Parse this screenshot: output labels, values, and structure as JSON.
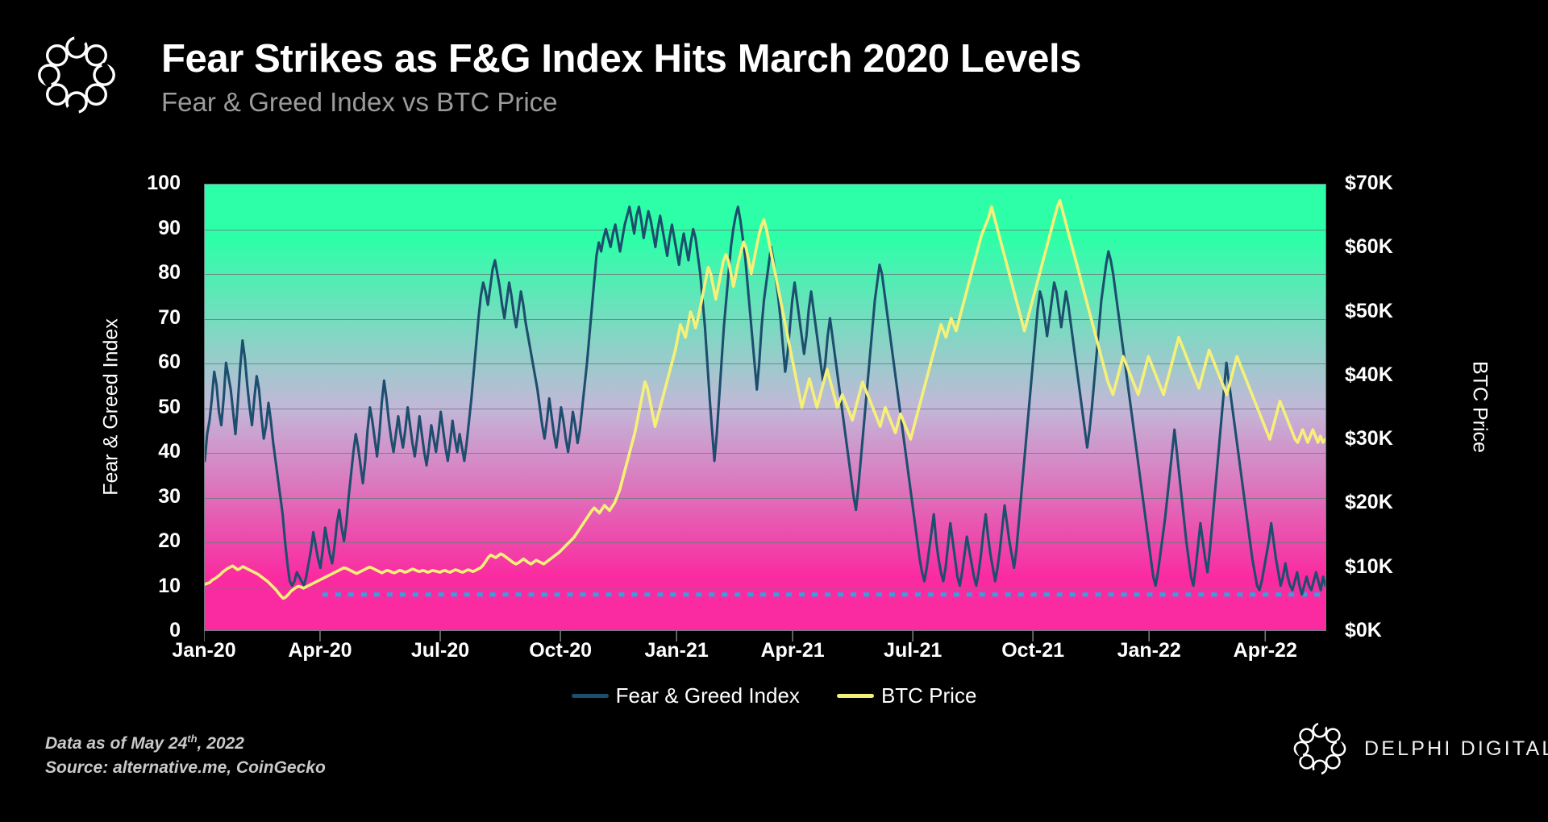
{
  "header": {
    "title": "Fear Strikes as F&G Index Hits March 2020 Levels",
    "subtitle": "Fear & Greed Index vs BTC Price",
    "logo_name": "delphi-knot-logo"
  },
  "footer": {
    "data_as_of_prefix": "Data as of May 24",
    "data_as_of_suffix": "th",
    "data_as_of_tail": ", 2022",
    "source": "Source: alternative.me, CoinGecko",
    "brand": "DELPHI DIGITAL"
  },
  "colors": {
    "background": "#000000",
    "fng_line": "#1d4e6e",
    "btc_line": "#f5f07a",
    "gradient_top": "#2dffa8",
    "gradient_mid": "#c2b8d8",
    "gradient_bottom": "#fa2ba0",
    "gridline": "#6d7c7c",
    "threshold_line": "#29a8e0",
    "subtitle": "#9b9b9b",
    "axis_text": "#ffffff"
  },
  "chart_data": {
    "type": "line",
    "title": "Fear Strikes as F&G Index Hits March 2020 Levels",
    "subtitle": "Fear & Greed Index vs BTC Price",
    "xlabel": "",
    "ylabel": "Fear & Greed Index",
    "y2label": "BTC Price",
    "grid": true,
    "legend_position": "bottom-center",
    "x_tick_labels": [
      "Jan-20",
      "Apr-20",
      "Jul-20",
      "Oct-20",
      "Jan-21",
      "Apr-21",
      "Jul-21",
      "Oct-21",
      "Jan-22",
      "Apr-22"
    ],
    "x_tick_positions": [
      0.0,
      0.1034,
      0.2105,
      0.3176,
      0.4211,
      0.5245,
      0.6316,
      0.7386,
      0.8421,
      0.9456
    ],
    "ylim": [
      0,
      100
    ],
    "y_ticks": [
      0,
      10,
      20,
      30,
      40,
      50,
      60,
      70,
      80,
      90,
      100
    ],
    "y2lim": [
      0,
      70000
    ],
    "y2_ticks": [
      0,
      10000,
      20000,
      30000,
      40000,
      50000,
      60000,
      70000
    ],
    "y2_tick_labels": [
      "$0K",
      "$10K",
      "$20K",
      "$30K",
      "$40K",
      "$50K",
      "$60K",
      "$70K"
    ],
    "threshold": {
      "value": 8,
      "label": "extreme-fear-floor",
      "style": "dotted",
      "color": "#29a8e0",
      "x_start": 0.105
    },
    "series": [
      {
        "name": "Fear & Greed Index",
        "axis": "left",
        "color": "#1d4e6e",
        "values": [
          38,
          44,
          47,
          52,
          58,
          55,
          49,
          46,
          52,
          60,
          57,
          54,
          49,
          44,
          51,
          59,
          65,
          61,
          55,
          50,
          46,
          52,
          57,
          54,
          48,
          43,
          46,
          51,
          47,
          42,
          38,
          34,
          30,
          26,
          20,
          15,
          11,
          10,
          11,
          13,
          12,
          11,
          10,
          12,
          15,
          18,
          22,
          19,
          16,
          14,
          18,
          23,
          20,
          17,
          15,
          19,
          24,
          27,
          23,
          20,
          24,
          30,
          35,
          40,
          44,
          41,
          37,
          33,
          38,
          45,
          50,
          47,
          43,
          39,
          44,
          51,
          56,
          52,
          47,
          43,
          40,
          44,
          48,
          44,
          41,
          45,
          50,
          46,
          42,
          39,
          43,
          48,
          44,
          40,
          37,
          41,
          46,
          43,
          40,
          44,
          49,
          45,
          41,
          38,
          42,
          47,
          43,
          40,
          44,
          41,
          38,
          42,
          47,
          52,
          58,
          64,
          70,
          75,
          78,
          76,
          73,
          77,
          81,
          83,
          80,
          77,
          73,
          70,
          74,
          78,
          75,
          71,
          68,
          72,
          76,
          73,
          69,
          66,
          63,
          60,
          57,
          54,
          50,
          46,
          43,
          47,
          52,
          48,
          44,
          41,
          45,
          50,
          47,
          43,
          40,
          44,
          49,
          46,
          42,
          45,
          50,
          55,
          60,
          66,
          72,
          78,
          84,
          87,
          85,
          88,
          90,
          88,
          86,
          89,
          91,
          88,
          85,
          88,
          91,
          93,
          95,
          92,
          89,
          93,
          95,
          92,
          88,
          91,
          94,
          92,
          89,
          86,
          90,
          93,
          90,
          87,
          84,
          88,
          91,
          88,
          85,
          82,
          86,
          89,
          86,
          83,
          87,
          90,
          88,
          84,
          80,
          74,
          68,
          60,
          52,
          45,
          38,
          44,
          52,
          60,
          68,
          74,
          80,
          86,
          90,
          93,
          95,
          92,
          88,
          84,
          78,
          72,
          66,
          60,
          54,
          60,
          68,
          74,
          78,
          82,
          86,
          83,
          79,
          75,
          70,
          64,
          58,
          62,
          68,
          74,
          78,
          74,
          70,
          66,
          62,
          66,
          72,
          76,
          72,
          68,
          64,
          60,
          56,
          60,
          66,
          70,
          66,
          62,
          58,
          54,
          50,
          46,
          42,
          38,
          34,
          30,
          27,
          32,
          38,
          44,
          50,
          56,
          62,
          68,
          74,
          78,
          82,
          80,
          76,
          72,
          68,
          64,
          60,
          56,
          52,
          48,
          44,
          40,
          36,
          32,
          28,
          24,
          20,
          16,
          13,
          11,
          14,
          18,
          22,
          26,
          20,
          16,
          13,
          11,
          14,
          19,
          24,
          20,
          16,
          12,
          10,
          13,
          17,
          21,
          18,
          15,
          12,
          10,
          13,
          17,
          22,
          26,
          21,
          17,
          14,
          11,
          14,
          18,
          23,
          28,
          24,
          20,
          17,
          14,
          18,
          24,
          30,
          36,
          42,
          48,
          54,
          60,
          66,
          72,
          76,
          74,
          70,
          66,
          70,
          74,
          78,
          76,
          72,
          68,
          72,
          76,
          73,
          69,
          65,
          61,
          57,
          53,
          49,
          45,
          41,
          45,
          50,
          56,
          62,
          68,
          74,
          78,
          82,
          85,
          83,
          80,
          76,
          72,
          68,
          64,
          60,
          56,
          52,
          48,
          44,
          40,
          36,
          32,
          28,
          24,
          20,
          16,
          12,
          10,
          13,
          17,
          21,
          25,
          30,
          35,
          40,
          45,
          40,
          35,
          30,
          25,
          20,
          16,
          12,
          10,
          14,
          19,
          24,
          20,
          16,
          13,
          18,
          24,
          30,
          36,
          42,
          48,
          54,
          60,
          56,
          52,
          48,
          44,
          40,
          36,
          32,
          28,
          24,
          20,
          16,
          13,
          10,
          9,
          11,
          14,
          17,
          20,
          24,
          20,
          16,
          13,
          10,
          12,
          15,
          12,
          10,
          9,
          11,
          13,
          10,
          8,
          10,
          12,
          10,
          9,
          11,
          13,
          11,
          9,
          12,
          10
        ]
      },
      {
        "name": "BTC Price",
        "axis": "right",
        "color": "#f5f07a",
        "values": [
          7200,
          7350,
          7500,
          7900,
          8100,
          8400,
          8700,
          9100,
          9400,
          9700,
          9900,
          10100,
          9800,
          9500,
          9700,
          10000,
          9800,
          9600,
          9400,
          9200,
          9000,
          8800,
          8500,
          8200,
          7900,
          7600,
          7200,
          6800,
          6400,
          5900,
          5400,
          5000,
          5200,
          5600,
          6100,
          6400,
          6700,
          6900,
          6800,
          6600,
          6800,
          7000,
          7200,
          7400,
          7600,
          7800,
          8000,
          8200,
          8400,
          8600,
          8800,
          9000,
          9200,
          9400,
          9600,
          9800,
          9700,
          9500,
          9300,
          9100,
          8900,
          9100,
          9300,
          9500,
          9700,
          9900,
          9800,
          9600,
          9400,
          9200,
          9000,
          9200,
          9400,
          9300,
          9100,
          9000,
          9200,
          9400,
          9300,
          9100,
          9200,
          9400,
          9600,
          9500,
          9300,
          9200,
          9400,
          9300,
          9100,
          9200,
          9400,
          9300,
          9200,
          9100,
          9300,
          9400,
          9200,
          9100,
          9300,
          9500,
          9400,
          9200,
          9100,
          9300,
          9500,
          9400,
          9200,
          9400,
          9600,
          9800,
          10200,
          10800,
          11400,
          11800,
          11600,
          11400,
          11700,
          12000,
          11800,
          11500,
          11200,
          10900,
          10600,
          10400,
          10600,
          10900,
          11200,
          10900,
          10600,
          10400,
          10700,
          11000,
          10800,
          10600,
          10400,
          10700,
          11000,
          11300,
          11600,
          11900,
          12200,
          12600,
          13000,
          13400,
          13800,
          14200,
          14600,
          15200,
          15800,
          16400,
          17000,
          17600,
          18200,
          18800,
          19200,
          18800,
          18400,
          19000,
          19600,
          19200,
          18800,
          19400,
          20000,
          21000,
          22000,
          23500,
          25000,
          26500,
          28000,
          29500,
          31000,
          33000,
          35000,
          37000,
          39000,
          38000,
          36000,
          34000,
          32000,
          33500,
          35000,
          36500,
          38000,
          39500,
          41000,
          42500,
          44000,
          46000,
          48000,
          47000,
          46000,
          48000,
          50000,
          49000,
          47500,
          49000,
          51000,
          53000,
          55000,
          57000,
          56000,
          54000,
          52000,
          54000,
          56000,
          58000,
          59000,
          58000,
          56000,
          54000,
          56000,
          58000,
          59500,
          61000,
          60000,
          58000,
          56000,
          58000,
          60000,
          62000,
          63500,
          64500,
          63000,
          61000,
          59000,
          57000,
          55000,
          53000,
          51000,
          49000,
          47000,
          45000,
          43000,
          41000,
          39000,
          37000,
          35000,
          36500,
          38000,
          39500,
          38000,
          36500,
          35000,
          36500,
          38000,
          39500,
          41000,
          39500,
          38000,
          36500,
          35000,
          36000,
          37000,
          36000,
          35000,
          34000,
          33000,
          34500,
          36000,
          37500,
          39000,
          38000,
          37000,
          36000,
          35000,
          34000,
          33000,
          32000,
          33500,
          35000,
          34000,
          33000,
          32000,
          31000,
          32500,
          34000,
          33000,
          32000,
          31000,
          30000,
          31500,
          33000,
          34500,
          36000,
          37500,
          39000,
          40500,
          42000,
          43500,
          45000,
          46500,
          48000,
          47000,
          46000,
          47500,
          49000,
          48000,
          47000,
          48500,
          50000,
          51500,
          53000,
          54500,
          56000,
          57500,
          59000,
          60500,
          62000,
          63000,
          64000,
          65000,
          66500,
          65000,
          63500,
          62000,
          60500,
          59000,
          57500,
          56000,
          54500,
          53000,
          51500,
          50000,
          48500,
          47000,
          48500,
          50000,
          51500,
          53000,
          54500,
          56000,
          57500,
          59000,
          60500,
          62000,
          63500,
          65000,
          66500,
          67500,
          66000,
          64500,
          63000,
          61500,
          60000,
          58500,
          57000,
          55500,
          54000,
          52500,
          51000,
          49500,
          48000,
          46500,
          45000,
          43500,
          42000,
          40500,
          39000,
          38000,
          37000,
          38500,
          40000,
          41500,
          43000,
          42000,
          41000,
          40000,
          39000,
          38000,
          37000,
          38500,
          40000,
          41500,
          43000,
          42000,
          41000,
          40000,
          39000,
          38000,
          37000,
          38500,
          40000,
          41500,
          43000,
          44500,
          46000,
          45000,
          44000,
          43000,
          42000,
          41000,
          40000,
          39000,
          38000,
          39500,
          41000,
          42500,
          44000,
          43000,
          42000,
          41000,
          40000,
          39000,
          38000,
          37000,
          38500,
          40000,
          41500,
          43000,
          42000,
          41000,
          40000,
          39000,
          38000,
          37000,
          36000,
          35000,
          34000,
          33000,
          32000,
          31000,
          30000,
          31500,
          33000,
          34500,
          36000,
          35000,
          34000,
          33000,
          32000,
          31000,
          30000,
          29500,
          30500,
          31500,
          30500,
          29500,
          30500,
          31500,
          30500,
          29500,
          30500,
          29500,
          30000
        ]
      }
    ]
  },
  "legend": {
    "items": [
      {
        "label": "Fear & Greed Index",
        "color": "#1d4e6e"
      },
      {
        "label": "BTC Price",
        "color": "#f5f07a"
      }
    ]
  }
}
